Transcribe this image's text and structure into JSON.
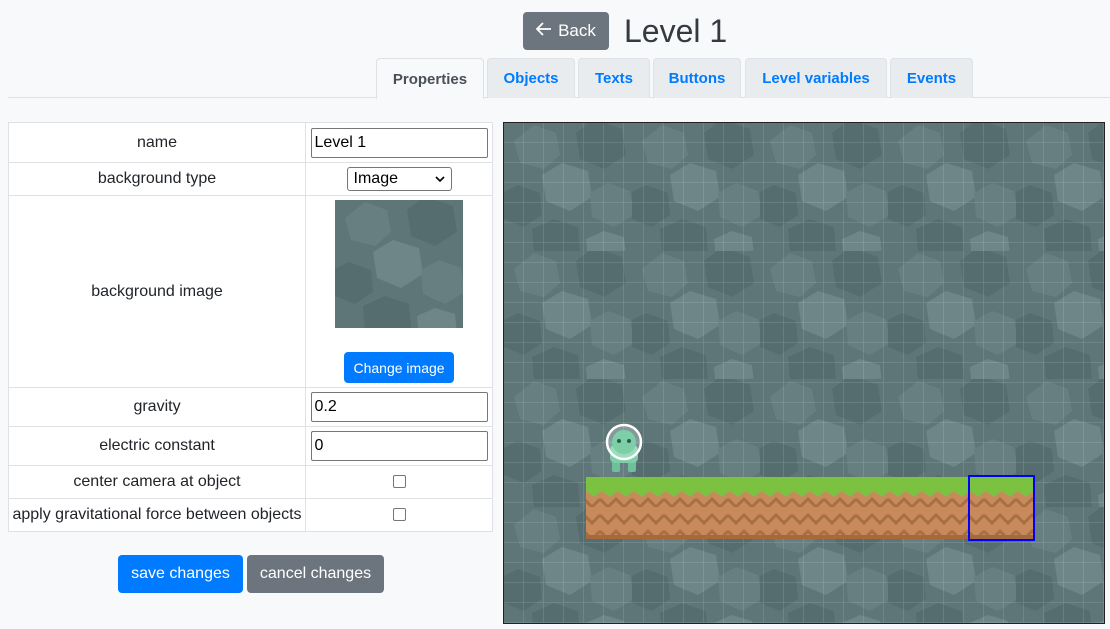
{
  "header": {
    "back_label": "Back",
    "title": "Level 1"
  },
  "tabs": [
    {
      "label": "Properties",
      "active": true
    },
    {
      "label": "Objects",
      "active": false
    },
    {
      "label": "Texts",
      "active": false
    },
    {
      "label": "Buttons",
      "active": false
    },
    {
      "label": "Level variables",
      "active": false
    },
    {
      "label": "Events",
      "active": false
    }
  ],
  "properties": {
    "name": {
      "label": "name",
      "value": "Level 1"
    },
    "background_type": {
      "label": "background type",
      "selected": "Image"
    },
    "background_image": {
      "label": "background image",
      "change_label": "Change image"
    },
    "gravity": {
      "label": "gravity",
      "value": "0.2"
    },
    "electric_constant": {
      "label": "electric constant",
      "value": "0"
    },
    "center_camera": {
      "label": "center camera at object",
      "checked": false
    },
    "apply_gravity": {
      "label": "apply gravitational force between objects",
      "checked": false
    }
  },
  "actions": {
    "save_label": "save changes",
    "cancel_label": "cancel changes"
  },
  "colors": {
    "primary": "#007bff",
    "secondary": "#6c757d",
    "background_tile": "#5f7678",
    "grass": "#7cc241",
    "dirt": "#c88a5a",
    "selection": "#0000ff"
  },
  "icons": {
    "back": "arrow-left-icon",
    "select": "chevron-down-icon"
  }
}
